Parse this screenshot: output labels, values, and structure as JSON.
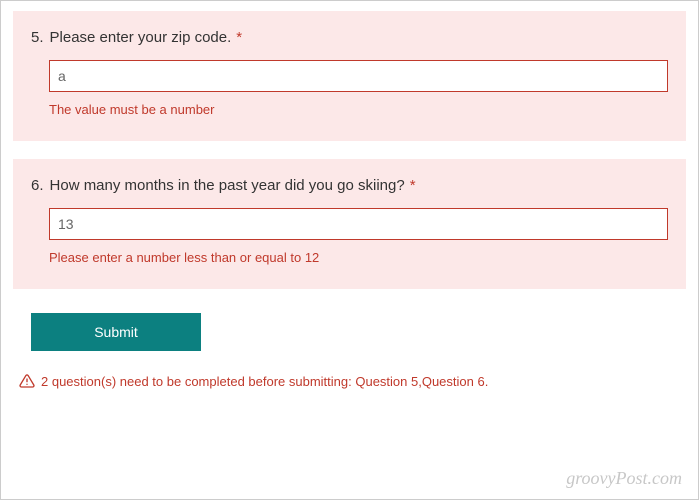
{
  "questions": [
    {
      "number": "5.",
      "text": "Please enter your zip code.",
      "required_marker": "*",
      "value": "a",
      "error": "The value must be a number"
    },
    {
      "number": "6.",
      "text": "How many months in the past year did you go skiing?",
      "required_marker": "*",
      "value": "13",
      "error": "Please enter a number less than or equal to 12"
    }
  ],
  "submit_label": "Submit",
  "footer_error": "2 question(s) need to be completed before submitting: Question 5,Question 6.",
  "watermark": "groovyPost.com"
}
